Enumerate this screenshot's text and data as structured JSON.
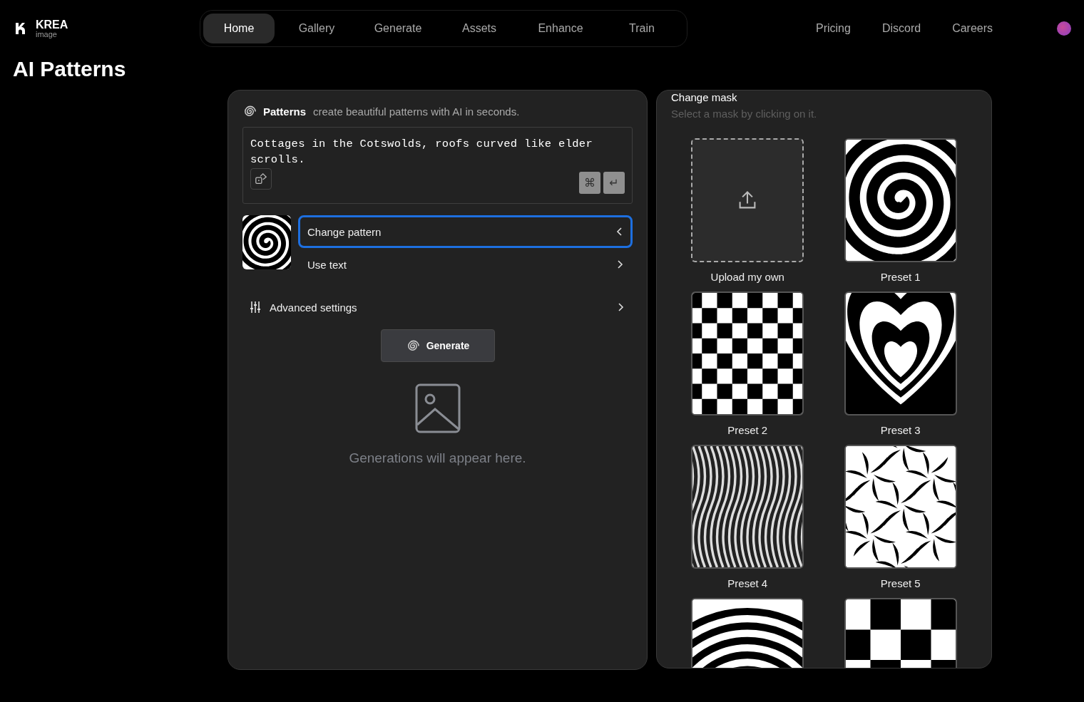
{
  "brand": {
    "name": "KREA",
    "sub": "image"
  },
  "nav": {
    "tabs": [
      {
        "label": "Home",
        "selected": true
      },
      {
        "label": "Gallery",
        "selected": false
      },
      {
        "label": "Generate",
        "selected": false
      },
      {
        "label": "Assets",
        "selected": false
      },
      {
        "label": "Enhance",
        "selected": false
      },
      {
        "label": "Train",
        "selected": false
      }
    ],
    "links": [
      "Pricing",
      "Discord",
      "Careers"
    ]
  },
  "page_title": "AI Patterns",
  "patterns_panel": {
    "title": "Patterns",
    "subtitle": "create beautiful patterns with AI in seconds.",
    "prompt": "Cottages in the Cotswolds, roofs curved like elder scrolls.",
    "keys": [
      "⌘",
      "↵"
    ],
    "current_pattern": {
      "kind": "spiral"
    },
    "options": [
      {
        "label": "Change pattern",
        "selected": true
      },
      {
        "label": "Use text",
        "selected": false
      }
    ],
    "advanced": "Advanced settings",
    "generate": "Generate",
    "empty": "Generations will appear here."
  },
  "mask_panel": {
    "title": "Change mask",
    "subtitle": "Select a mask by clicking on it.",
    "masks": [
      {
        "kind": "upload",
        "label": "Upload my own"
      },
      {
        "kind": "spiral",
        "label": "Preset 1"
      },
      {
        "kind": "checker",
        "label": "Preset 2"
      },
      {
        "kind": "heart",
        "label": "Preset 3"
      },
      {
        "kind": "waves",
        "label": "Preset 4"
      },
      {
        "kind": "swirl",
        "label": "Preset 5"
      },
      {
        "kind": "rings"
      },
      {
        "kind": "bigchecker"
      }
    ]
  }
}
